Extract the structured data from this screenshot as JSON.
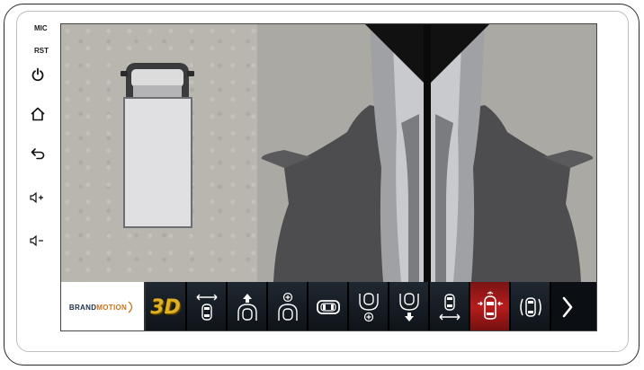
{
  "device": {
    "mic_label": "MIC",
    "rst_label": "RST",
    "side_buttons": [
      "power-icon",
      "home-icon",
      "back-icon",
      "volume-up-icon",
      "volume-down-icon"
    ]
  },
  "toolbar": {
    "brand_part1": "BRAND",
    "brand_part2": "MOTION",
    "btn_3d_label": "3D",
    "active_color": "#b81c1c",
    "buttons": [
      "3d-view-icon",
      "front-wide-icon",
      "front-view-icon",
      "front-zoom-icon",
      "top-view-icon",
      "rear-zoom-icon",
      "rear-view-icon",
      "rear-wide-icon",
      "side-view-icon",
      "side-mirror-view-icon",
      "next-arrow-icon"
    ],
    "active_button": "side-view-icon"
  }
}
